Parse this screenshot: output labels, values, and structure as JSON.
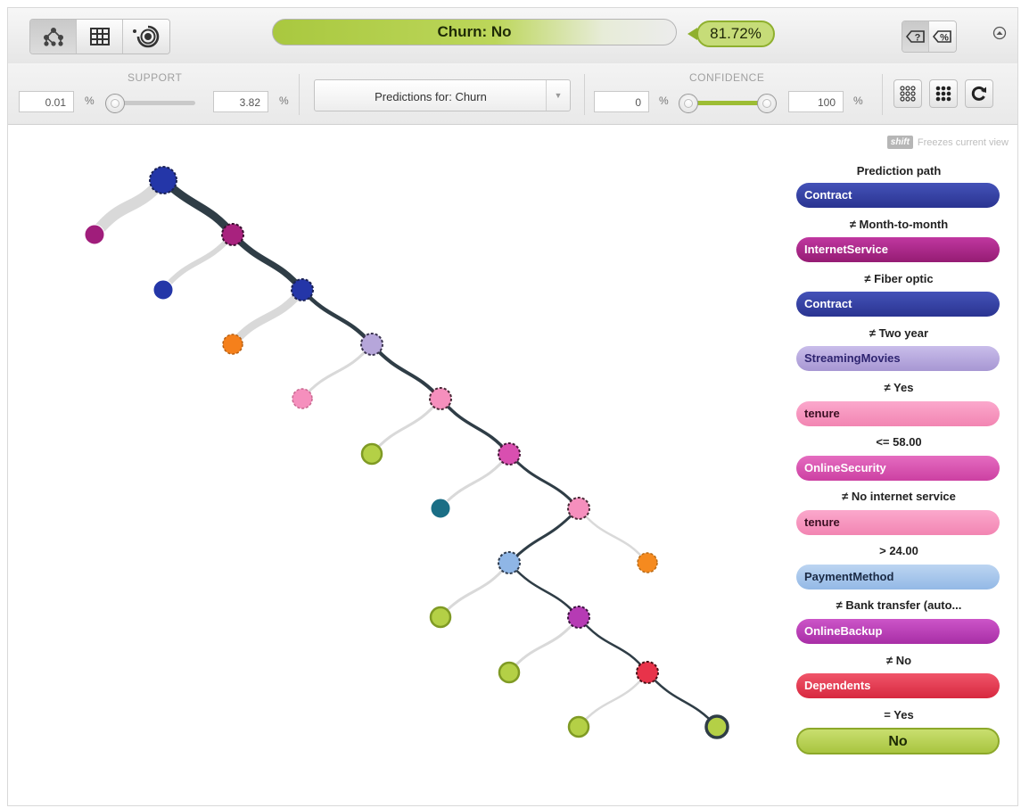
{
  "prediction": {
    "label": "Churn: No",
    "confidence": "81.72%"
  },
  "toolbar": {
    "view_modes": [
      "tree-view-icon",
      "table-view-icon",
      "sunburst-view-icon"
    ],
    "mode_buttons": [
      "question-mark-mode-icon",
      "percent-mode-icon"
    ]
  },
  "support": {
    "label": "SUPPORT",
    "min": "0.01",
    "max": "3.82",
    "unit": "%"
  },
  "target_select": {
    "value": "Predictions for: Churn"
  },
  "confidence_filter": {
    "label": "CONFIDENCE",
    "min": "0",
    "max": "100",
    "unit": "%"
  },
  "hint": {
    "key": "shift",
    "text": "Freezes current view"
  },
  "path_panel": {
    "title": "Prediction path",
    "steps": [
      {
        "field": "Contract",
        "condition": "≠ Month-to-month",
        "color": "#2f3a9e"
      },
      {
        "field": "InternetService",
        "condition": "≠ Fiber optic",
        "color": "#a8227e"
      },
      {
        "field": "Contract",
        "condition": "≠ Two year",
        "color": "#2f3a9e"
      },
      {
        "field": "StreamingMovies",
        "condition": "≠ Yes",
        "color": "#b6a6da"
      },
      {
        "field": "tenure",
        "condition": "<= 58.00",
        "color": "#f68fb7"
      },
      {
        "field": "OnlineSecurity",
        "condition": "≠ No internet service",
        "color": "#d94fb0"
      },
      {
        "field": "tenure",
        "condition": "> 24.00",
        "color": "#f68fb7"
      },
      {
        "field": "PaymentMethod",
        "condition": "≠ Bank transfer (auto...",
        "color": "#a5c6ea"
      },
      {
        "field": "OnlineBackup",
        "condition": "≠ No",
        "color": "#b63bb4"
      },
      {
        "field": "Dependents",
        "condition": "= Yes",
        "color": "#e8334a"
      }
    ],
    "result": "No"
  },
  "colors": {
    "path_edge": "#2f3d46",
    "other_edge": "#d9d9d9",
    "leaf_green": "#b4d046",
    "leaf_orange": "#f58a1f",
    "leaf_teal": "#1a6e85"
  }
}
